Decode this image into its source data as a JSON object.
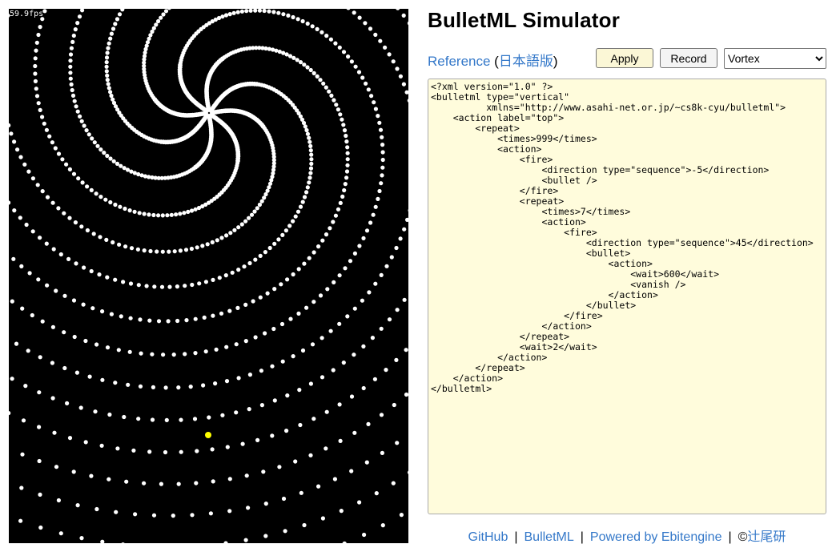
{
  "game": {
    "fps_text": "59.9fps",
    "background": "#000000",
    "bullet_color": "#ffffff",
    "player_color": "#ffff00",
    "pattern": "vortex-spiral"
  },
  "header": {
    "title": "BulletML Simulator",
    "reference_label": "Reference",
    "paren_open": " (",
    "japanese_label": "日本語版",
    "paren_close": ")"
  },
  "toolbar": {
    "apply_label": "Apply",
    "record_label": "Record",
    "preset_options": [
      "Vortex"
    ],
    "preset_selected": "Vortex"
  },
  "editor": {
    "xml": "<?xml version=\"1.0\" ?>\n<bulletml type=\"vertical\"\n          xmlns=\"http://www.asahi-net.or.jp/~cs8k-cyu/bulletml\">\n    <action label=\"top\">\n        <repeat>\n            <times>999</times>\n            <action>\n                <fire>\n                    <direction type=\"sequence\">-5</direction>\n                    <bullet />\n                </fire>\n                <repeat>\n                    <times>7</times>\n                    <action>\n                        <fire>\n                            <direction type=\"sequence\">45</direction>\n                            <bullet>\n                                <action>\n                                    <wait>600</wait>\n                                    <vanish />\n                                </action>\n                            </bullet>\n                        </fire>\n                    </action>\n                </repeat>\n                <wait>2</wait>\n            </action>\n        </repeat>\n    </action>\n</bulletml>"
  },
  "footer": {
    "github": "GitHub",
    "bulletml": "BulletML",
    "ebitengine": "Powered by Ebitengine",
    "separator": "|",
    "copyright": "©",
    "author": "辻尾研"
  },
  "colors": {
    "link": "#3478c9",
    "editor_bg": "#fffcdc",
    "apply_bg": "#fbf7d6"
  }
}
